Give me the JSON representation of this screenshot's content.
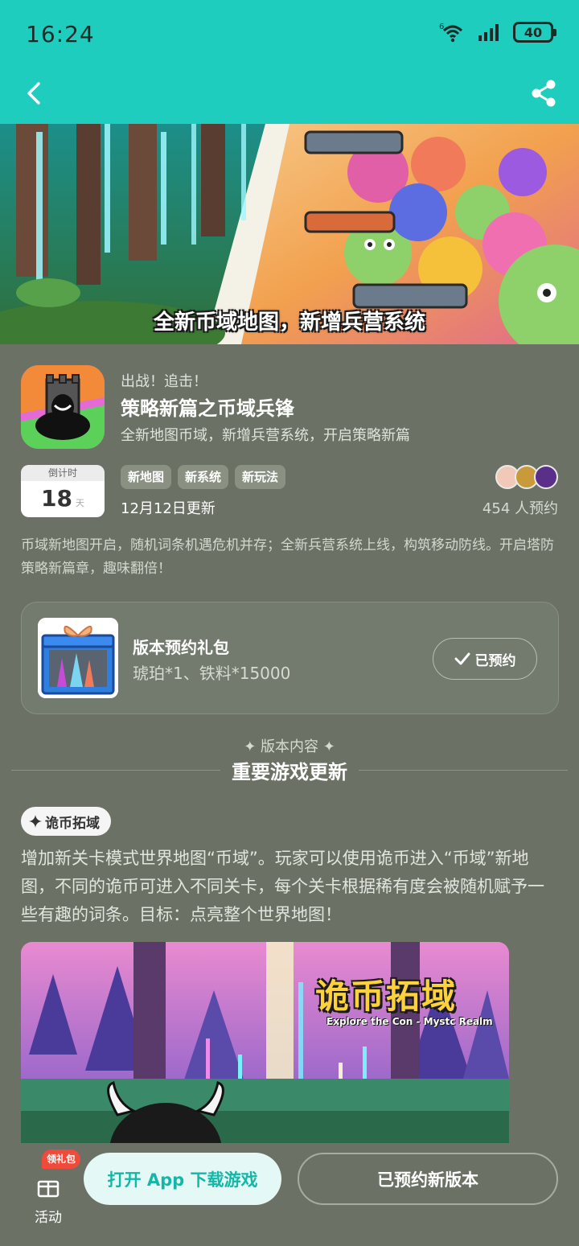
{
  "status_bar": {
    "time": "16:24",
    "battery": "40",
    "network_label": "6"
  },
  "nav": {
    "back_icon": "chevron-left-icon",
    "share_icon": "share-icon",
    "bg_color": "#1ecdbd"
  },
  "banner": {
    "caption": "全新币域地图，新增兵营系统"
  },
  "app": {
    "subtitle": "出战！追击！",
    "title": "策略新篇之币域兵锋",
    "description": "全新地图币域，新增兵营系统，开启策略新篇"
  },
  "countdown": {
    "label": "倒计时",
    "value": "18",
    "unit": "天"
  },
  "tags": [
    "新地图",
    "新系统",
    "新玩法"
  ],
  "update_date": "12月12日更新",
  "reserve_count": "454 人预约",
  "intro": "币域新地图开启，随机词条机遇危机并存；全新兵营系统上线，构筑移动防线。开启塔防策略新篇章，趣味翻倍！",
  "gift": {
    "title": "版本预约礼包",
    "description": "琥珀*1、铁料*15000",
    "button_label": "已预约"
  },
  "section": {
    "label": "✦ 版本内容 ✦",
    "title": "重要游戏更新"
  },
  "feature": {
    "chip_label": "诡币拓域",
    "text": "增加新关卡模式世界地图“币域”。玩家可以使用诡币进入“币域”新地图，不同的诡币可进入不同关卡，每个关卡根据稀有度会被随机赋予一些有趣的词条。目标：点亮整个世界地图！",
    "image_title": "诡币拓域",
    "image_subtitle": "Explore the Con - Mystc Realm"
  },
  "bottom": {
    "activity_label": "活动",
    "gift_badge": "领礼包",
    "open_app_label": "打开 App 下载游戏",
    "reserved_label": "已预约新版本"
  }
}
